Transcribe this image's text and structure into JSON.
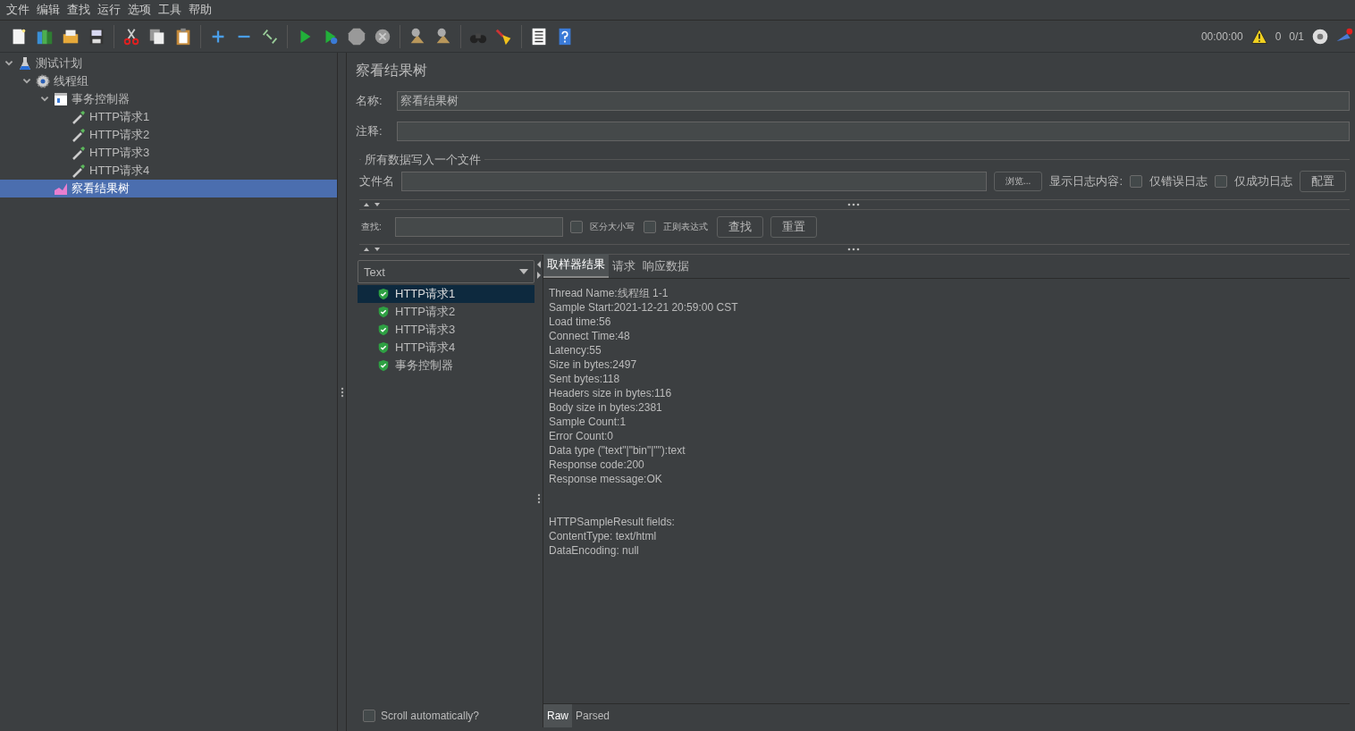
{
  "menu": [
    "文件",
    "编辑",
    "查找",
    "运行",
    "选项",
    "工具",
    "帮助"
  ],
  "status": {
    "timer": "00:00:00",
    "warnings": "0",
    "threads": "0/1"
  },
  "tree": [
    {
      "label": "测试计划",
      "kind": "plan",
      "expanded": true,
      "selected": false,
      "children": [
        {
          "label": "线程组",
          "kind": "thread-group",
          "expanded": true,
          "selected": false,
          "children": [
            {
              "label": "事务控制器",
              "kind": "controller",
              "expanded": true,
              "selected": false,
              "children": [
                {
                  "label": "HTTP请求1",
                  "kind": "sampler",
                  "selected": false
                },
                {
                  "label": "HTTP请求2",
                  "kind": "sampler",
                  "selected": false
                },
                {
                  "label": "HTTP请求3",
                  "kind": "sampler",
                  "selected": false
                },
                {
                  "label": "HTTP请求4",
                  "kind": "sampler",
                  "selected": false
                }
              ]
            },
            {
              "label": "察看结果树",
              "kind": "listener",
              "selected": true
            }
          ]
        }
      ]
    }
  ],
  "panel": {
    "title": "察看结果树",
    "name_label": "名称:",
    "name_value": "察看结果树",
    "comment_label": "注释:",
    "file_group": "所有数据写入一个文件",
    "file_label": "文件名",
    "browse": "浏览...",
    "log_label": "显示日志内容:",
    "log_options": [
      {
        "label": "仅错误日志",
        "checked": false
      },
      {
        "label": "仅成功日志",
        "checked": false
      }
    ],
    "configure": "配置"
  },
  "search": {
    "label": "查找:",
    "options": [
      {
        "label": "区分大小写",
        "checked": false
      },
      {
        "label": "正则表达式",
        "checked": false
      }
    ],
    "find": "查找",
    "reset": "重置"
  },
  "renderer": "Text",
  "results": [
    {
      "label": "HTTP请求1",
      "success": true,
      "selected": true
    },
    {
      "label": "HTTP请求2",
      "success": true,
      "selected": false
    },
    {
      "label": "HTTP请求3",
      "success": true,
      "selected": false
    },
    {
      "label": "HTTP请求4",
      "success": true,
      "selected": false
    },
    {
      "label": "事务控制器",
      "success": true,
      "selected": false
    }
  ],
  "scroll_auto": {
    "label": "Scroll automatically?",
    "checked": false
  },
  "tabs": [
    {
      "label": "取样器结果",
      "selected": true
    },
    {
      "label": "请求",
      "selected": false
    },
    {
      "label": "响应数据",
      "selected": false
    }
  ],
  "details": [
    [
      "Thread Name:线程组 1-1",
      "Sample Start:2021-12-21 20:59:00 CST",
      "Load time:56",
      "Connect Time:48",
      "Latency:55",
      "Size in bytes:2497",
      "Sent bytes:118",
      "Headers size in bytes:116",
      "Body size in bytes:2381",
      "Sample Count:1",
      "Error Count:0",
      "Data type (\"text\"|\"bin\"|\"\"):text",
      "Response code:200",
      "Response message:OK"
    ],
    [
      "HTTPSampleResult fields:",
      "ContentType: text/html",
      "DataEncoding: null"
    ]
  ],
  "view_tabs": [
    {
      "label": "Raw",
      "selected": true
    },
    {
      "label": "Parsed",
      "selected": false
    }
  ]
}
